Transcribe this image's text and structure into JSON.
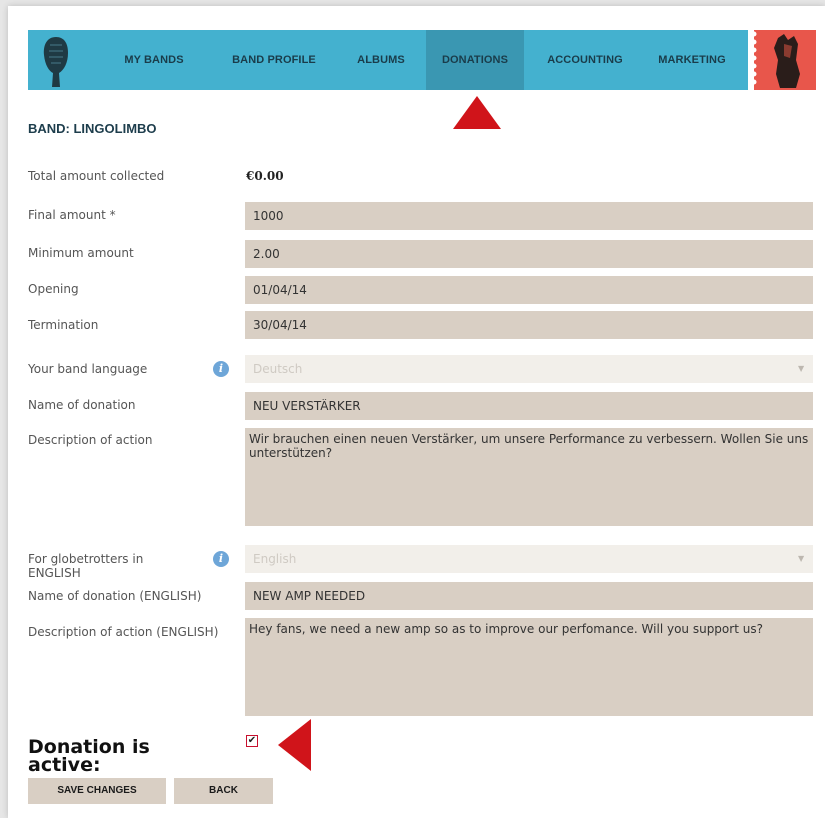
{
  "nav": {
    "items": [
      {
        "label": "MY BANDS"
      },
      {
        "label": "BAND PROFILE"
      },
      {
        "label": "ALBUMS"
      },
      {
        "label": "DONATIONS"
      },
      {
        "label": "ACCOUNTING"
      },
      {
        "label": "MARKETING"
      }
    ],
    "active": "DONATIONS",
    "colors": {
      "bar": "#44b1cf",
      "active": "#3a97b2",
      "stamp": "#e8564b",
      "arrow": "#d0141a"
    }
  },
  "band": {
    "title": "BAND: LINGOLIMBO"
  },
  "form": {
    "total": {
      "label": "Total amount collected",
      "value": "€0.00"
    },
    "final_amount": {
      "label": "Final amount  *",
      "value": "1000"
    },
    "minimum_amount": {
      "label": "Minimum amount",
      "value": "2.00"
    },
    "opening": {
      "label": "Opening",
      "value": "01/04/14"
    },
    "termination": {
      "label": "Termination",
      "value": "30/04/14"
    },
    "band_language": {
      "label": "Your band language",
      "value": "Deutsch"
    },
    "donation_name": {
      "label": "Name of donation",
      "value": "NEU VERSTÄRKER"
    },
    "description": {
      "label": "Description of action",
      "value": "Wir brauchen einen neuen Verstärker, um unsere Performance zu verbessern. Wollen Sie uns unterstützen?"
    },
    "globetrotters": {
      "label": "For globetrotters in ENGLISH",
      "value": "English"
    },
    "donation_name_en": {
      "label": "Name of donation (ENGLISH)",
      "value": "NEW AMP NEEDED"
    },
    "description_en": {
      "label": "Description of action (ENGLISH)",
      "value": "Hey fans, we need a new amp so as to improve our perfomance. Will you support us?"
    },
    "active": {
      "label": "Donation is active:",
      "checked": true
    }
  },
  "buttons": {
    "save": "SAVE CHANGES",
    "back": "BACK"
  }
}
